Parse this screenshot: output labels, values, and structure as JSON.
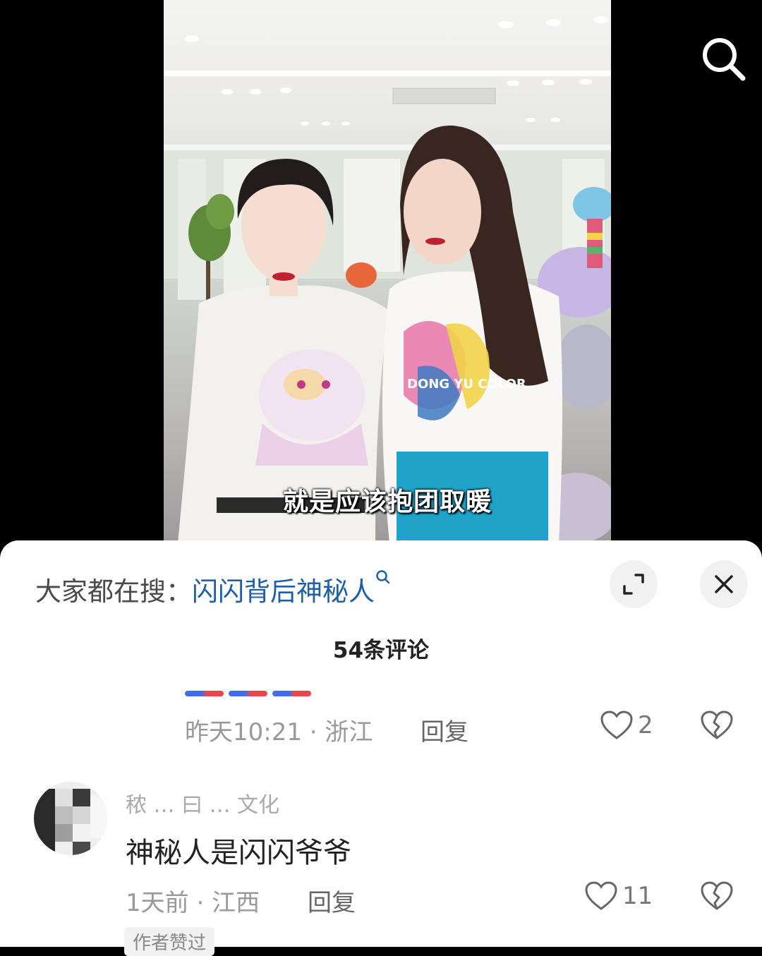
{
  "video": {
    "subtitle": "就是应该抱团取暖",
    "shirt_print": "DONG YU COLOR"
  },
  "icons": {
    "search": "search-icon",
    "expand": "expand-icon",
    "close": "close-icon",
    "like": "heart-icon",
    "dislike": "broken-heart-icon"
  },
  "colors": {
    "link_blue": "#1f5fa8",
    "text_gray": "#999999",
    "sheet_bg": "#ffffff"
  },
  "sheet": {
    "trend_label": "大家都在搜：",
    "trend_link": "闪闪背后神秘人",
    "comment_count_title": "54条评论"
  },
  "comments": [
    {
      "time": "昨天10:21",
      "location": "浙江",
      "reply_label": "回复",
      "likes": "2"
    },
    {
      "username": "秾 … 曰 … 文化",
      "text": "神秘人是闪闪爷爷",
      "time": "1天前",
      "location": "江西",
      "reply_label": "回复",
      "likes": "11",
      "badge": "作者赞过"
    }
  ]
}
